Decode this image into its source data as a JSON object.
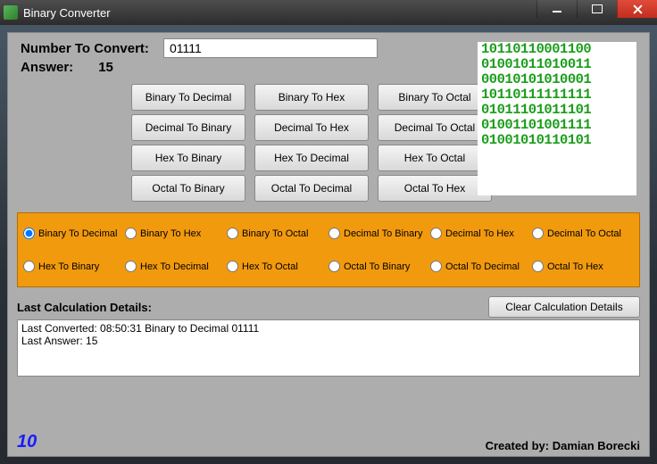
{
  "window": {
    "title": "Binary Converter"
  },
  "input": {
    "label": "Number To Convert:",
    "value": "01111"
  },
  "answer": {
    "label": "Answer:",
    "value": "15"
  },
  "buttons": [
    "Binary To Decimal",
    "Binary To Hex",
    "Binary To Octal",
    "Decimal To Binary",
    "Decimal To Hex",
    "Decimal To Octal",
    "Hex To Binary",
    "Hex To Decimal",
    "Hex To Octal",
    "Octal To Binary",
    "Octal To Decimal",
    "Octal To Hex"
  ],
  "radios": [
    {
      "label": "Binary To Decimal",
      "checked": true
    },
    {
      "label": "Binary To Hex",
      "checked": false
    },
    {
      "label": "Binary To Octal",
      "checked": false
    },
    {
      "label": "Decimal To Binary",
      "checked": false
    },
    {
      "label": "Decimal To Hex",
      "checked": false
    },
    {
      "label": "Decimal To Octal",
      "checked": false
    },
    {
      "label": "Hex To Binary",
      "checked": false
    },
    {
      "label": "Hex To Decimal",
      "checked": false
    },
    {
      "label": "Hex To Octal",
      "checked": false
    },
    {
      "label": "Octal To Binary",
      "checked": false
    },
    {
      "label": "Octal To Decimal",
      "checked": false
    },
    {
      "label": "Octal To Hex",
      "checked": false
    }
  ],
  "details": {
    "heading": "Last Calculation Details:",
    "clear_label": "Clear Calculation Details",
    "line1": "Last Converted: 08:50:31  Binary to Decimal 01111",
    "line2": "Last Answer: 15"
  },
  "footer": {
    "counter": "10",
    "credit": "Created by: Damian Borecki"
  },
  "binart": [
    "10110110001100",
    "01001011010011",
    "00010101010001",
    "10110111111111",
    "01011101011101",
    "01001101001111",
    "01001010110101"
  ]
}
